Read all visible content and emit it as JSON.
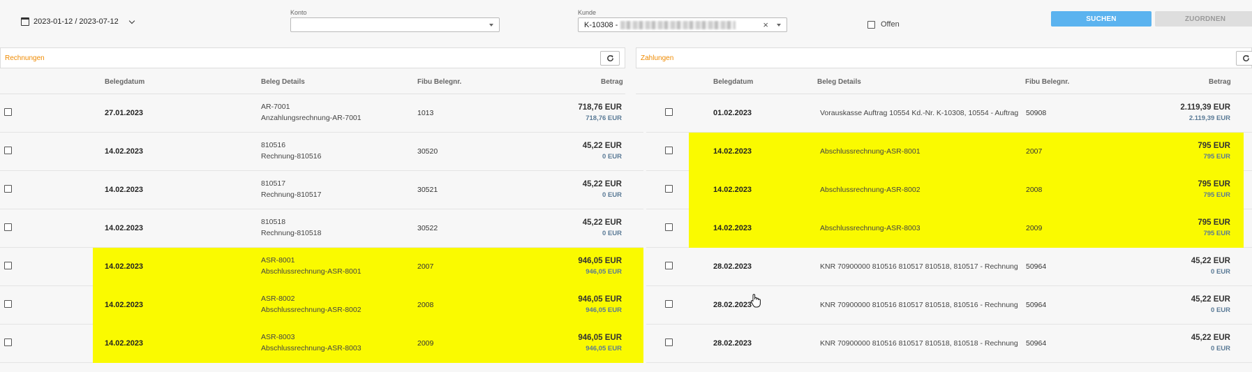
{
  "filters": {
    "date_range": "2023-01-12 / 2023-07-12",
    "konto_label": "Konto",
    "konto_value": "",
    "kunde_label": "Kunde",
    "kunde_value": "K-10308 -",
    "offen_label": "Offen",
    "offen_checked": false,
    "search_label": "SUCHEN",
    "assign_label": "ZUORDNEN"
  },
  "colors": {
    "accent": "#5bb3ef",
    "panel_title": "#ef8a00",
    "highlight": "#fafa00"
  },
  "rechnungen": {
    "title": "Rechnungen",
    "columns": [
      "Belegdatum",
      "Beleg Details",
      "Fibu Belegnr.",
      "Betrag"
    ],
    "rows": [
      {
        "date": "27.01.2023",
        "detail1": "AR-7001",
        "detail2": "Anzahlungsrechnung-AR-7001",
        "fibu": "1013",
        "amount": "718,76 EUR",
        "open": "718,76 EUR",
        "highlighted": false
      },
      {
        "date": "14.02.2023",
        "detail1": "810516",
        "detail2": "Rechnung-810516",
        "fibu": "30520",
        "amount": "45,22 EUR",
        "open": "0 EUR",
        "highlighted": false
      },
      {
        "date": "14.02.2023",
        "detail1": "810517",
        "detail2": "Rechnung-810517",
        "fibu": "30521",
        "amount": "45,22 EUR",
        "open": "0 EUR",
        "highlighted": false
      },
      {
        "date": "14.02.2023",
        "detail1": "810518",
        "detail2": "Rechnung-810518",
        "fibu": "30522",
        "amount": "45,22 EUR",
        "open": "0 EUR",
        "highlighted": false
      },
      {
        "date": "14.02.2023",
        "detail1": "ASR-8001",
        "detail2": "Abschlussrechnung-ASR-8001",
        "fibu": "2007",
        "amount": "946,05 EUR",
        "open": "946,05 EUR",
        "highlighted": true
      },
      {
        "date": "14.02.2023",
        "detail1": "ASR-8002",
        "detail2": "Abschlussrechnung-ASR-8002",
        "fibu": "2008",
        "amount": "946,05 EUR",
        "open": "946,05 EUR",
        "highlighted": true
      },
      {
        "date": "14.02.2023",
        "detail1": "ASR-8003",
        "detail2": "Abschlussrechnung-ASR-8003",
        "fibu": "2009",
        "amount": "946,05 EUR",
        "open": "946,05 EUR",
        "highlighted": true
      }
    ]
  },
  "zahlungen": {
    "title": "Zahlungen",
    "columns": [
      "Belegdatum",
      "Beleg Details",
      "Fibu Belegnr.",
      "Betrag"
    ],
    "rows": [
      {
        "date": "01.02.2023",
        "detail": "Vorauskasse Auftrag 10554 Kd.-Nr. K-10308, 10554 - Auftrag",
        "fibu": "50908",
        "amount": "2.119,39 EUR",
        "open": "2.119,39 EUR",
        "highlighted": false
      },
      {
        "date": "14.02.2023",
        "detail": "Abschlussrechnung-ASR-8001",
        "fibu": "2007",
        "amount": "795 EUR",
        "open": "795 EUR",
        "highlighted": true
      },
      {
        "date": "14.02.2023",
        "detail": "Abschlussrechnung-ASR-8002",
        "fibu": "2008",
        "amount": "795 EUR",
        "open": "795 EUR",
        "highlighted": true
      },
      {
        "date": "14.02.2023",
        "detail": "Abschlussrechnung-ASR-8003",
        "fibu": "2009",
        "amount": "795 EUR",
        "open": "795 EUR",
        "highlighted": true
      },
      {
        "date": "28.02.2023",
        "detail": "KNR 70900000 810516 810517 810518, 810517 - Rechnung",
        "fibu": "50964",
        "amount": "45,22 EUR",
        "open": "0 EUR",
        "highlighted": false
      },
      {
        "date": "28.02.2023",
        "detail": "KNR 70900000 810516 810517 810518, 810516 - Rechnung",
        "fibu": "50964",
        "amount": "45,22 EUR",
        "open": "0 EUR",
        "highlighted": false
      },
      {
        "date": "28.02.2023",
        "detail": "KNR 70900000 810516 810517 810518, 810518 - Rechnung",
        "fibu": "50964",
        "amount": "45,22 EUR",
        "open": "0 EUR",
        "highlighted": false
      }
    ]
  }
}
